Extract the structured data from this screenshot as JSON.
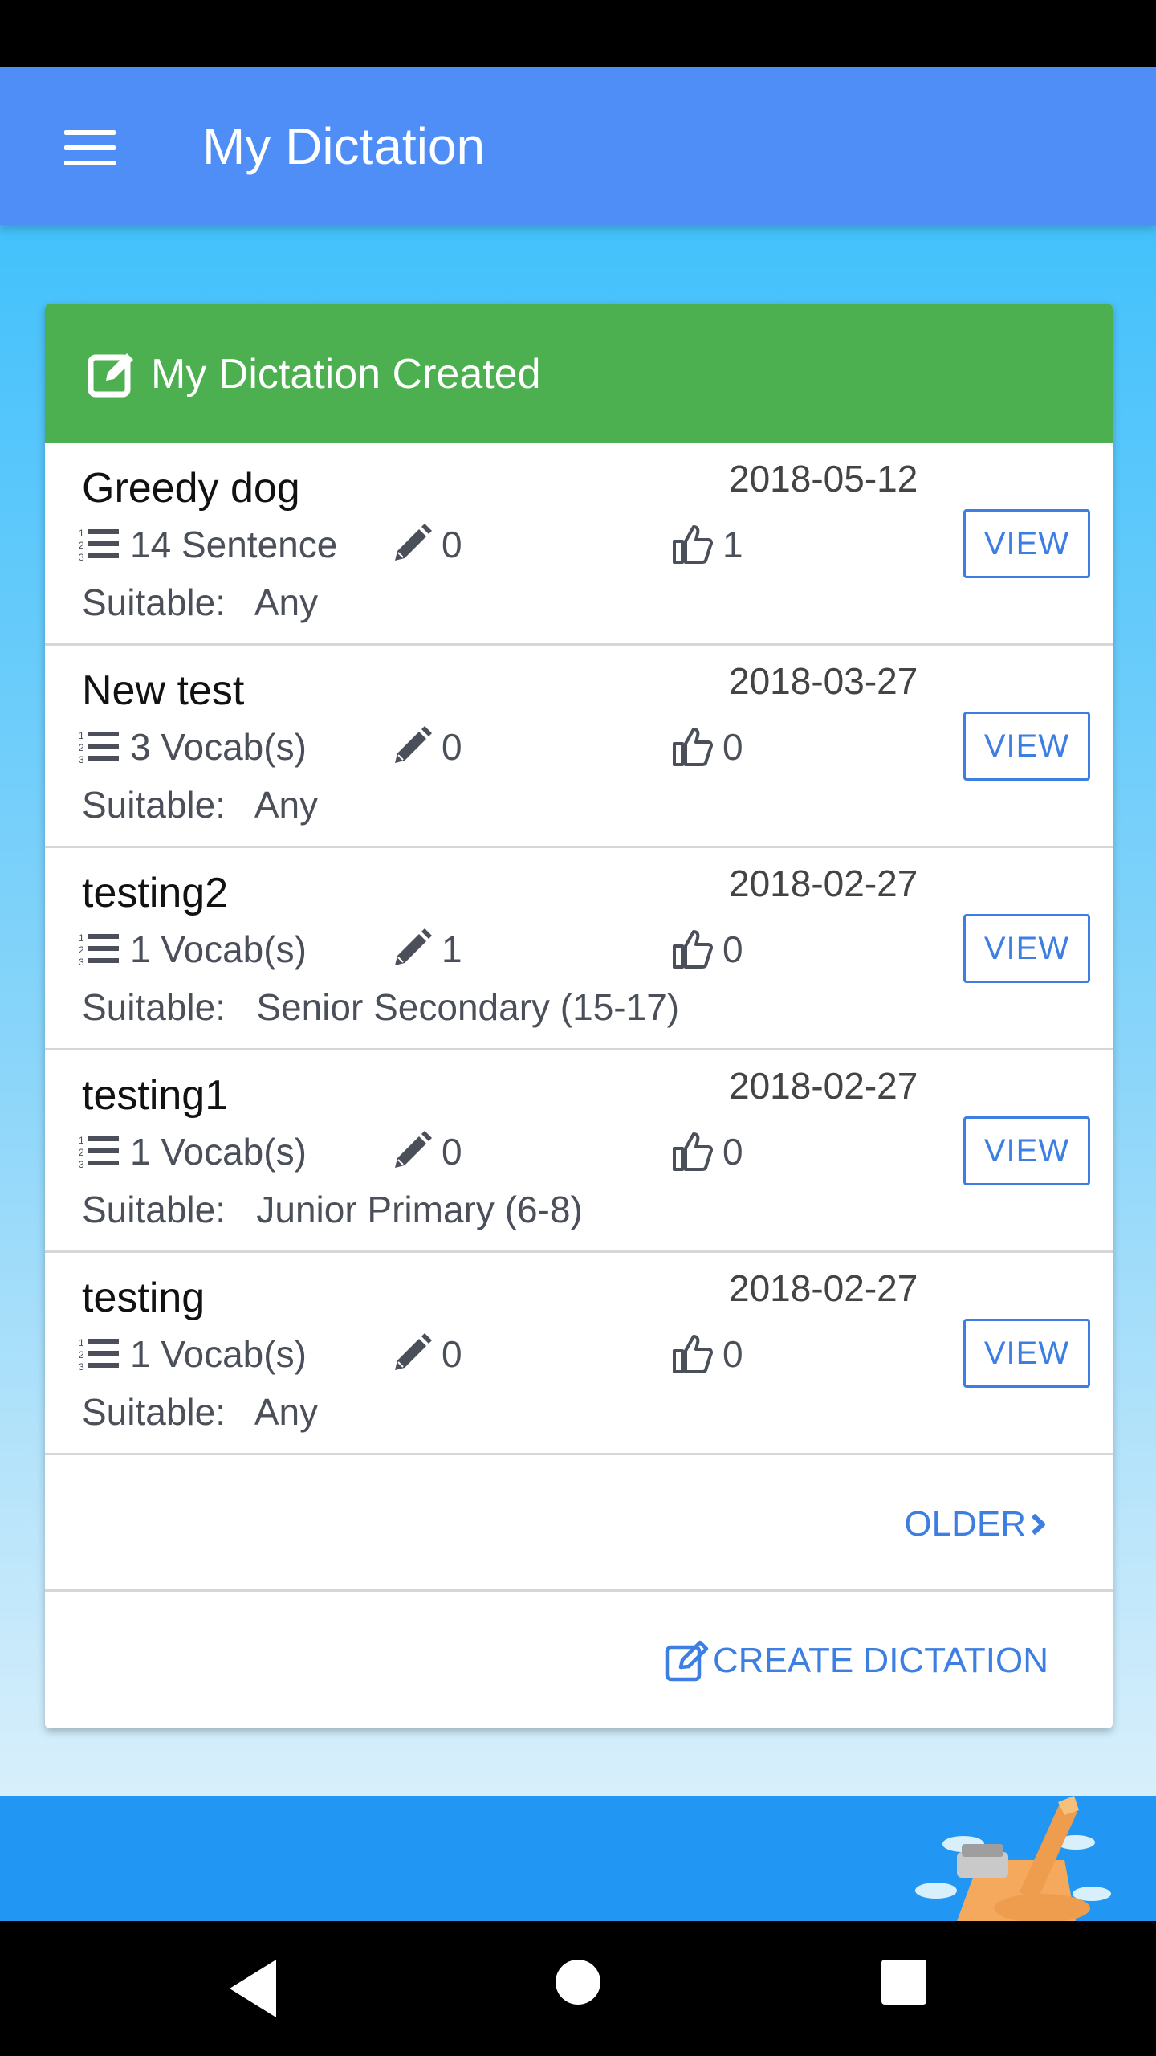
{
  "app_bar": {
    "title": "My Dictation"
  },
  "card": {
    "title": "My Dictation Created"
  },
  "dictations": [
    {
      "name": "Greedy dog",
      "date": "2018-05-12",
      "items": "14 Sentence",
      "edits": "0",
      "likes": "1",
      "suitable_label": "Suitable:",
      "suitable_value": "Any",
      "view_label": "VIEW"
    },
    {
      "name": "New test",
      "date": "2018-03-27",
      "items": "3 Vocab(s)",
      "edits": "0",
      "likes": "0",
      "suitable_label": "Suitable:",
      "suitable_value": "Any",
      "view_label": "VIEW"
    },
    {
      "name": "testing2",
      "date": "2018-02-27",
      "items": "1 Vocab(s)",
      "edits": "1",
      "likes": "0",
      "suitable_label": "Suitable:",
      "suitable_value": "Senior Secondary (15-17)",
      "view_label": "VIEW"
    },
    {
      "name": "testing1",
      "date": "2018-02-27",
      "items": "1 Vocab(s)",
      "edits": "0",
      "likes": "0",
      "suitable_label": "Suitable:",
      "suitable_value": "Junior Primary (6-8)",
      "view_label": "VIEW"
    },
    {
      "name": "testing",
      "date": "2018-02-27",
      "items": "1 Vocab(s)",
      "edits": "0",
      "likes": "0",
      "suitable_label": "Suitable:",
      "suitable_value": "Any",
      "view_label": "VIEW"
    }
  ],
  "older_label": "OLDER",
  "create_label": "CREATE DICTATION",
  "icons": {
    "menu": "hamburger-menu-icon",
    "header": "edit-square-icon",
    "items": "numbered-list-icon",
    "edits": "pencil-icon",
    "likes": "thumbs-up-icon",
    "older": "chevron-right-icon",
    "create": "edit-square-icon"
  },
  "colors": {
    "app_bar": "#4f8ef7",
    "card_header": "#4caf50",
    "accent": "#3d7ee2",
    "footer": "#2196f3"
  }
}
